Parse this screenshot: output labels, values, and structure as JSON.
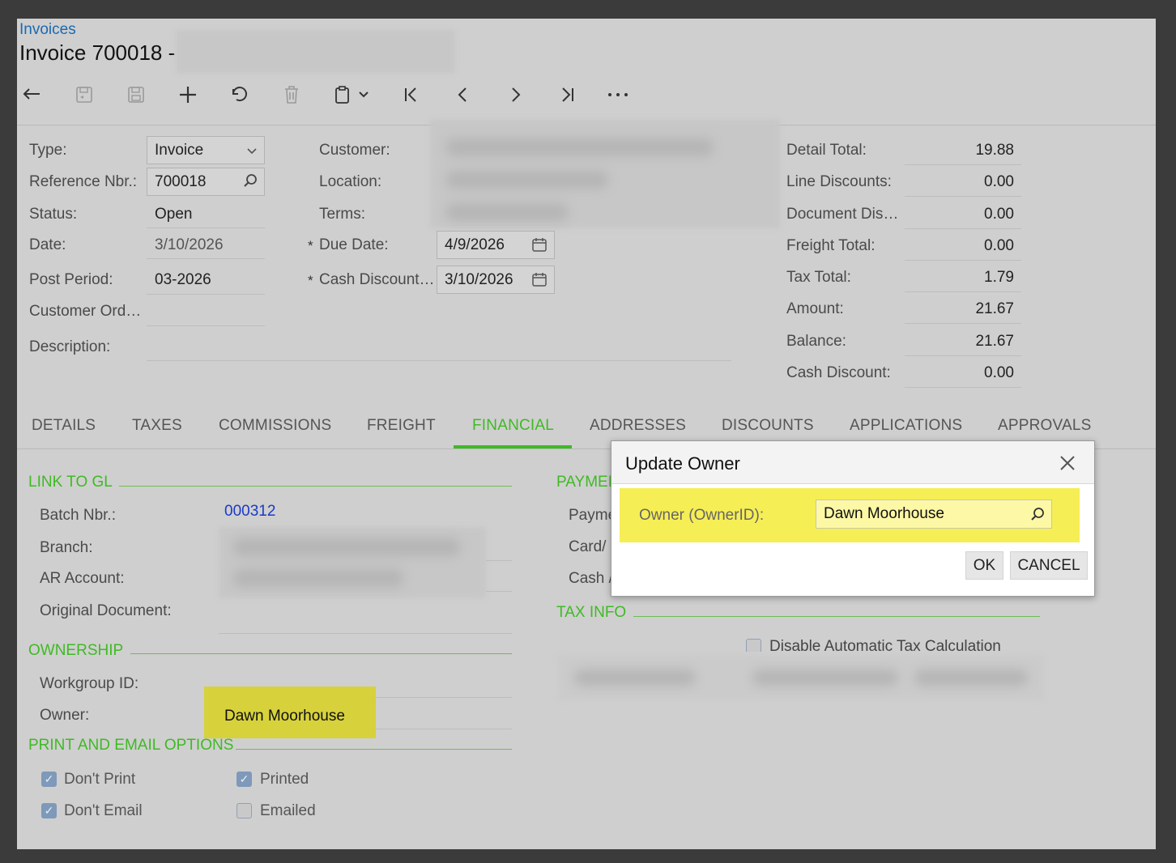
{
  "header": {
    "breadcrumb": "Invoices",
    "title": "Invoice 700018 -"
  },
  "toolbar": {
    "icons": [
      "back-icon",
      "cancel-save-icon",
      "save-icon",
      "add-icon",
      "undo-icon",
      "delete-icon",
      "copy-paste-icon",
      "first-icon",
      "previous-icon",
      "next-icon",
      "last-icon",
      "more-icon"
    ]
  },
  "summary": {
    "type_label": "Type:",
    "type_value": "Invoice",
    "ref_label": "Reference Nbr.:",
    "ref_value": "700018",
    "status_label": "Status:",
    "status_value": "Open",
    "date_label": "Date:",
    "date_value": "3/10/2026",
    "post_period_label": "Post Period:",
    "post_period_value": "03-2026",
    "customer_order_label": "Customer Ord…",
    "description_label": "Description:",
    "customer_label": "Customer:",
    "location_label": "Location:",
    "terms_label": "Terms:",
    "due_date_label": "Due Date:",
    "due_date_value": "4/9/2026",
    "cash_discount_date_label": "Cash Discount…",
    "cash_discount_date_value": "3/10/2026"
  },
  "totals": [
    {
      "label": "Detail Total:",
      "value": "19.88"
    },
    {
      "label": "Line Discounts:",
      "value": "0.00"
    },
    {
      "label": "Document Dis…",
      "value": "0.00"
    },
    {
      "label": "Freight Total:",
      "value": "0.00"
    },
    {
      "label": "Tax Total:",
      "value": "1.79"
    },
    {
      "label": "Amount:",
      "value": "21.67"
    },
    {
      "label": "Balance:",
      "value": "21.67"
    },
    {
      "label": "Cash Discount:",
      "value": "0.00"
    }
  ],
  "tabs": [
    "DETAILS",
    "TAXES",
    "COMMISSIONS",
    "FREIGHT",
    "FINANCIAL",
    "ADDRESSES",
    "DISCOUNTS",
    "APPLICATIONS",
    "APPROVALS"
  ],
  "financial": {
    "link_to_gl": "LINK TO GL",
    "batch_label": "Batch Nbr.:",
    "batch_value": "000312",
    "branch_label": "Branch:",
    "ar_account_label": "AR Account:",
    "original_doc_label": "Original Document:",
    "ownership": "OWNERSHIP",
    "workgroup_label": "Workgroup ID:",
    "owner_label": "Owner:",
    "owner_value": "Dawn Moorhouse",
    "print_email": "PRINT AND EMAIL OPTIONS",
    "dont_print": "Don't Print",
    "dont_email": "Don't Email",
    "printed": "Printed",
    "emailed": "Emailed",
    "payment_section": "PAYMEI",
    "payment_label_1": "Payme",
    "payment_label_2": "Card/",
    "payment_label_3": "Cash /",
    "tax_info": "TAX INFO",
    "disable_tax": "Disable Automatic Tax Calculation"
  },
  "dialog": {
    "title": "Update Owner",
    "owner_label": "Owner (OwnerID):",
    "owner_value": "Dawn Moorhouse",
    "ok": "OK",
    "cancel": "CANCEL"
  },
  "colors": {
    "accent": "#3fba24",
    "link": "#1a3ac9",
    "highlight": "#f6ee55"
  }
}
